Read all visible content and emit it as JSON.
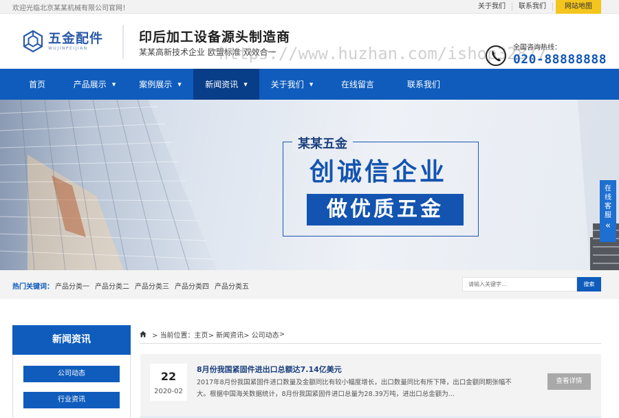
{
  "topbar": {
    "welcome": "欢迎光临北京某某机械有限公司官网！",
    "links": [
      "关于我们",
      "联系我们"
    ],
    "sitemap": "网站地图"
  },
  "logo": {
    "cn": "五金配件",
    "en": "WUJINPEIJIAN"
  },
  "slogan": {
    "line1": "印后加工设备源头制造商",
    "line2": "某某高新技术企业 欧盟标准 双效合一"
  },
  "watermark": "https://www.huzhan.com/ishop32877",
  "hotline": {
    "label": "全国咨询热线：",
    "number": "020-88888888"
  },
  "nav": {
    "items": [
      {
        "label": "首页"
      },
      {
        "label": "产品展示"
      },
      {
        "label": "案例展示"
      },
      {
        "label": "新闻资讯"
      },
      {
        "label": "关于我们"
      },
      {
        "label": "在线留言"
      },
      {
        "label": "联系我们"
      }
    ]
  },
  "banner": {
    "sub": "某某五金",
    "line1": "创诚信企业",
    "line2": "做优质五金"
  },
  "online_tab": {
    "text": "在线客服",
    "arrow": "«"
  },
  "keywords": {
    "label": "热门关键词：",
    "items": [
      "产品分类一",
      "产品分类二",
      "产品分类三",
      "产品分类四",
      "产品分类五"
    ]
  },
  "search": {
    "placeholder": "请输入关键字...",
    "button": "搜索"
  },
  "sidebar": {
    "title": "新闻资讯",
    "items": [
      "公司动态",
      "行业资讯"
    ]
  },
  "breadcrumb": {
    "prefix": "当前位置：主页",
    "items": [
      "新闻资讯",
      "公司动态",
      ""
    ]
  },
  "news": {
    "day": "22",
    "ym": "2020-02",
    "title": "8月份我国紧固件进出口总额达7.14亿美元",
    "desc": "2017年8月份我国紧固件进口数量及金额同比有较小幅度增长，出口数量同比有所下降，出口金额同期张幅不大。根据中国海关数据统计，8月份我国紧固件进口总量为28.39万吨，进出口总金额为...",
    "more": "查看详情"
  },
  "colors": {
    "primary": "#0f5cbd",
    "nav_active": "#083e88",
    "accent": "#f4c51c"
  }
}
